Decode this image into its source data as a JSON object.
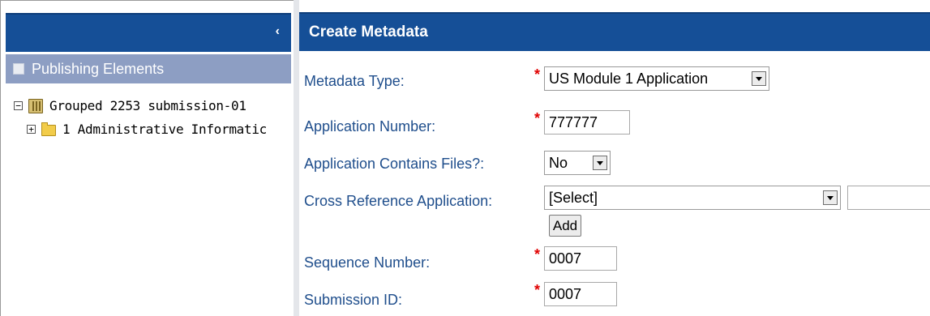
{
  "left_panel": {
    "collapse_glyph": "‹",
    "publishing_header": "Publishing Elements",
    "tree": [
      {
        "expander": "−",
        "icon": "book-icon",
        "label": "Grouped 2253 submission-01"
      },
      {
        "expander": "+",
        "icon": "folder-icon",
        "label": "1 Administrative Informatic"
      }
    ]
  },
  "form": {
    "title": "Create Metadata",
    "required_marker": "*",
    "metadata_type": {
      "label": "Metadata Type:",
      "value": "US Module 1 Application"
    },
    "application_number": {
      "label": "Application Number:",
      "value": "777777"
    },
    "contains_files": {
      "label": "Application Contains Files?:",
      "value": "No"
    },
    "cross_reference": {
      "label": "Cross Reference Application:",
      "value": "[Select]",
      "extra_value": ""
    },
    "add_button": "Add",
    "sequence_number": {
      "label": "Sequence Number:",
      "value": "0007"
    },
    "submission_id": {
      "label": "Submission ID:",
      "value": "0007"
    }
  },
  "colors": {
    "header_blue": "#154f97",
    "subheader_blue": "#8d9ec3",
    "label_blue": "#1f4e8c",
    "required_red": "#e00000"
  }
}
